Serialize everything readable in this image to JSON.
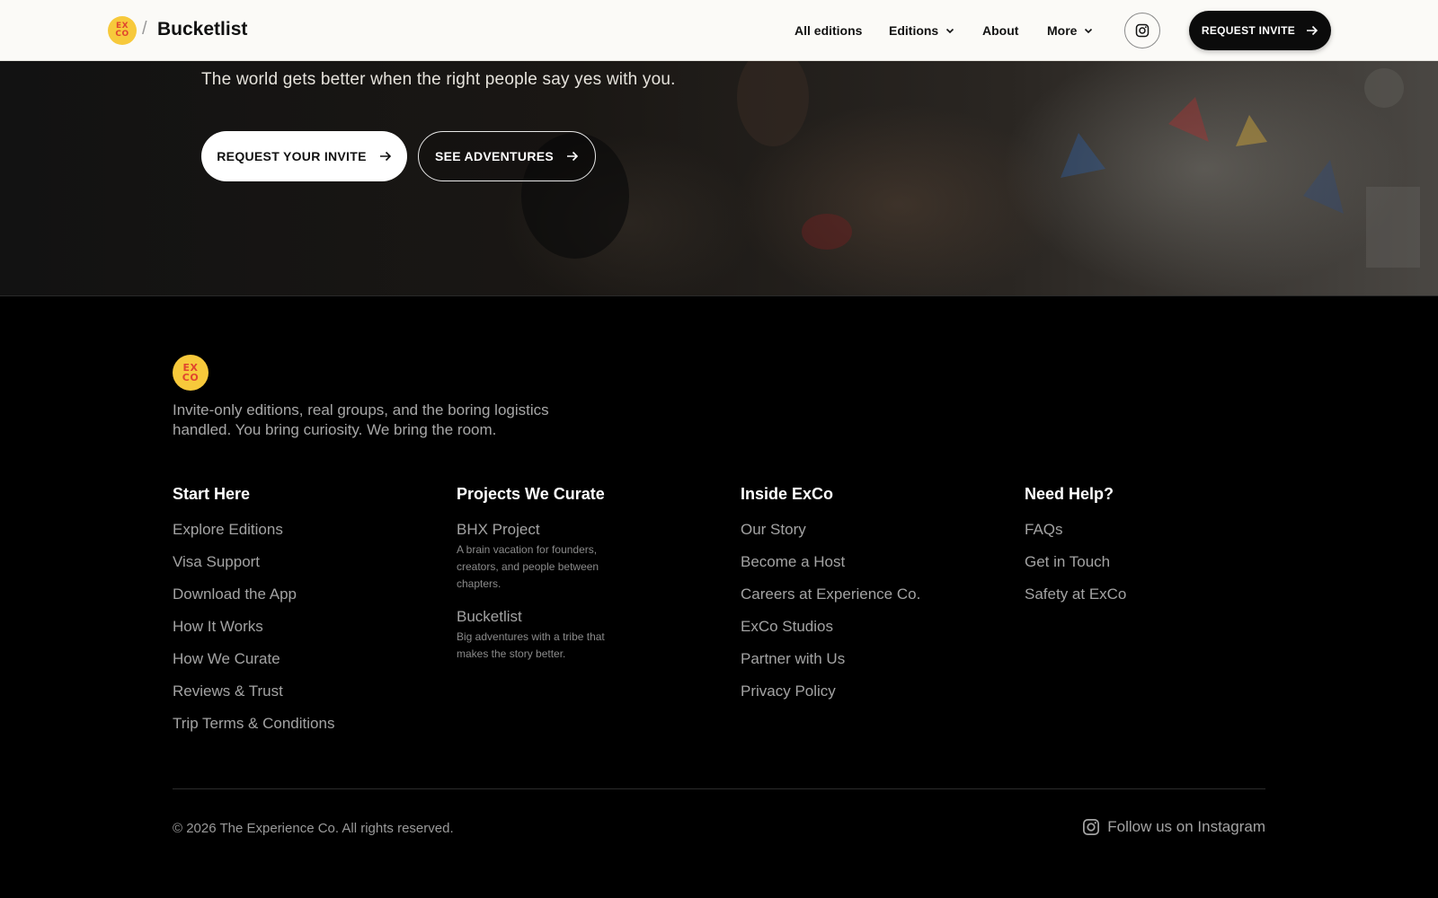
{
  "header": {
    "logo_text_line1": "EX",
    "logo_text_line2": "CO",
    "separator": "/",
    "brand": "Bucketlist",
    "nav": {
      "all_editions": "All editions",
      "editions": "Editions",
      "about": "About",
      "more": "More"
    },
    "request_invite": "REQUEST INVITE",
    "icons": {
      "instagram": "instagram-icon",
      "chevron": "chevron-down-icon",
      "arrow": "arrow-right-icon"
    }
  },
  "hero": {
    "subtitle": "The world gets better when the right people say yes with you.",
    "primary_cta": "REQUEST YOUR INVITE",
    "secondary_cta": "SEE ADVENTURES"
  },
  "footer": {
    "logo_text_line1": "EX",
    "logo_text_line2": "CO",
    "tagline": "Invite-only editions, real groups, and the boring logistics handled. You bring curiosity. We bring the room.",
    "columns": [
      {
        "title": "Start Here",
        "links": [
          "Explore Editions",
          "Visa Support",
          "Download the App",
          "How It Works",
          "How We Curate",
          "Reviews & Trust",
          "Trip Terms & Conditions"
        ]
      },
      {
        "title": "Projects We Curate",
        "projects": [
          {
            "title": "BHX Project",
            "desc": "A brain vacation for founders, creators, and people between chapters."
          },
          {
            "title": "Bucketlist",
            "desc": "Big adventures with a tribe that makes the story better."
          }
        ]
      },
      {
        "title": "Inside ExCo",
        "links": [
          "Our Story",
          "Become a Host",
          "Careers at Experience Co.",
          "ExCo Studios",
          "Partner with Us",
          "Privacy Policy"
        ]
      },
      {
        "title": "Need Help?",
        "links": [
          "FAQs",
          "Get in Touch",
          "Safety at ExCo"
        ]
      }
    ],
    "copyright": "© 2026 The Experience Co. All rights reserved.",
    "follow": "Follow us on Instagram"
  },
  "colors": {
    "accent_yellow": "#f7c93b",
    "logo_red": "#e0452e",
    "header_bg": "#fbfaf7",
    "footer_bg": "#000000"
  }
}
